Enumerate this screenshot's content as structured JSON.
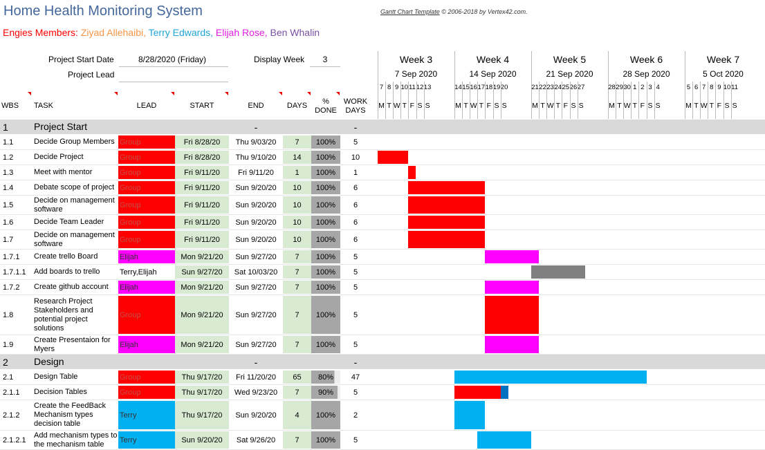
{
  "title": "Home Health Monitoring System",
  "credit": {
    "link": "Gantt Chart Template",
    "rest": " © 2006-2018 by Vertex42.com."
  },
  "members": {
    "label": "Engies Members: ",
    "names": [
      {
        "name": "Ziyad Allehaibi",
        "sep": ", ",
        "color": "#f79646"
      },
      {
        "name": "Terry Edwards",
        "sep": ", ",
        "color": "#20a4d8"
      },
      {
        "name": "Elijah Rose",
        "sep": ", ",
        "color": "#e020e0"
      },
      {
        "name": "Ben Whalin",
        "sep": "",
        "color": "#7a4fa5"
      }
    ]
  },
  "fields": {
    "start_label": "Project Start Date",
    "start_value": "8/28/2020 (Friday)",
    "lead_label": "Project Lead",
    "lead_value": "",
    "week_label": "Display Week",
    "week_value": "3"
  },
  "columns": {
    "wbs": "WBS",
    "task": "TASK",
    "lead": "LEAD",
    "start": "START",
    "end": "END",
    "days": "DAYS",
    "done1": "%",
    "done2": "DONE",
    "work1": "WORK",
    "work2": "DAYS"
  },
  "weeks": [
    {
      "label": "Week 3",
      "date": "7 Sep 2020",
      "days": [
        "7",
        "8",
        "9",
        "10",
        "11",
        "12",
        "13"
      ]
    },
    {
      "label": "Week 4",
      "date": "14 Sep 2020",
      "days": [
        "14",
        "15",
        "16",
        "17",
        "18",
        "19",
        "20"
      ]
    },
    {
      "label": "Week 5",
      "date": "21 Sep 2020",
      "days": [
        "21",
        "22",
        "23",
        "24",
        "25",
        "26",
        "27"
      ]
    },
    {
      "label": "Week 6",
      "date": "28 Sep 2020",
      "days": [
        "28",
        "29",
        "30",
        "1",
        "2",
        "3",
        "4"
      ]
    },
    {
      "label": "Week 7",
      "date": "5 Oct 2020",
      "days": [
        "5",
        "6",
        "7",
        "8",
        "9",
        "10",
        "11"
      ]
    }
  ],
  "weekday_letters": [
    "M",
    "T",
    "W",
    "T",
    "F",
    "S",
    "S"
  ],
  "colors": {
    "red": "#ff0000",
    "magenta": "#ff00ff",
    "blue": "#00b0f0",
    "gray": "#808080",
    "green_cell": "#d9ead3",
    "progress": "#a6a6a6",
    "phase": "#d9d9d9",
    "dark_blue": "#0070c0"
  },
  "rows": [
    {
      "type": "phase",
      "wbs": "1",
      "task": "Project Start",
      "end": "-",
      "work": "-"
    },
    {
      "wbs": "1.1",
      "task": "Decide Group Members",
      "lead": "Group",
      "lead_color": "red",
      "start": "Fri 8/28/20",
      "end": "Thu 9/03/20",
      "days": "7",
      "done": "100%",
      "work": "5",
      "bar": null
    },
    {
      "wbs": "1.2",
      "task": "Decide Project",
      "lead": "Group",
      "lead_color": "red",
      "start": "Fri 8/28/20",
      "end": "Thu 9/10/20",
      "days": "14",
      "done": "100%",
      "work": "10",
      "bar": {
        "from": 0,
        "to": 4,
        "color": "red"
      }
    },
    {
      "wbs": "1.3",
      "task": "Meet with mentor",
      "lead": "Group",
      "lead_color": "red",
      "start": "Fri 9/11/20",
      "end": "Fri 9/11/20",
      "days": "1",
      "done": "100%",
      "work": "1",
      "bar": {
        "from": 4,
        "to": 5,
        "color": "red"
      }
    },
    {
      "wbs": "1.4",
      "task": "Debate scope of project",
      "lead": "Group",
      "lead_color": "red",
      "start": "Fri 9/11/20",
      "end": "Sun 9/20/20",
      "days": "10",
      "done": "100%",
      "work": "6",
      "bar": {
        "from": 4,
        "to": 14,
        "color": "red"
      }
    },
    {
      "wbs": "1.5",
      "task": "Decide on management software",
      "lead": "Group",
      "lead_color": "red",
      "start": "Fri 9/11/20",
      "end": "Sun 9/20/20",
      "days": "10",
      "done": "100%",
      "work": "6",
      "tall": true,
      "bar": {
        "from": 4,
        "to": 14,
        "color": "red"
      }
    },
    {
      "wbs": "1.6",
      "task": "Decide Team Leader",
      "lead": "Group",
      "lead_color": "red",
      "start": "Fri 9/11/20",
      "end": "Sun 9/20/20",
      "days": "10",
      "done": "100%",
      "work": "6",
      "bar": {
        "from": 4,
        "to": 14,
        "color": "red"
      }
    },
    {
      "wbs": "1.7",
      "task": "Decide on management software",
      "lead": "Group",
      "lead_color": "red",
      "start": "Fri 9/11/20",
      "end": "Sun 9/20/20",
      "days": "10",
      "done": "100%",
      "work": "6",
      "tall": true,
      "bar": {
        "from": 4,
        "to": 14,
        "color": "red"
      }
    },
    {
      "wbs": "1.7.1",
      "task": "Create trello Board",
      "lead": "Elijah",
      "lead_color": "magenta",
      "start": "Mon 9/21/20",
      "end": "Sun 9/27/20",
      "days": "7",
      "done": "100%",
      "work": "5",
      "bar": {
        "from": 14,
        "to": 21,
        "color": "magenta"
      }
    },
    {
      "wbs": "1.7.1.1",
      "task": "Add boards to trello",
      "lead": "Terry,Elijah",
      "lead_color": "none",
      "start": "Sun 9/27/20",
      "end": "Sat 10/03/20",
      "days": "7",
      "done": "100%",
      "work": "5",
      "bar": {
        "from": 20,
        "to": 27,
        "color": "gray"
      }
    },
    {
      "wbs": "1.7.2",
      "task": "Create github account",
      "lead": "Elijah",
      "lead_color": "magenta",
      "start": "Mon 9/21/20",
      "end": "Sun 9/27/20",
      "days": "7",
      "done": "100%",
      "work": "5",
      "bar": {
        "from": 14,
        "to": 21,
        "color": "magenta"
      }
    },
    {
      "wbs": "1.8",
      "task": "Research Project Stakeholders and potential project solutions",
      "lead": "Group",
      "lead_color": "red",
      "start": "Mon 9/21/20",
      "end": "Sun 9/27/20",
      "days": "7",
      "done": "100%",
      "work": "5",
      "huge": true,
      "bar": {
        "from": 14,
        "to": 21,
        "color": "red"
      }
    },
    {
      "wbs": "1.9",
      "task": "Create Presentaion for Myers",
      "lead": "Elijah",
      "lead_color": "magenta",
      "start": "Mon 9/21/20",
      "end": "Sun 9/27/20",
      "days": "7",
      "done": "100%",
      "work": "5",
      "tall": true,
      "bar": {
        "from": 14,
        "to": 21,
        "color": "magenta"
      }
    },
    {
      "type": "phase",
      "wbs": "2",
      "task": "Design",
      "end": "-",
      "work": "-"
    },
    {
      "wbs": "2.1",
      "task": "Design Table",
      "lead": "Group",
      "lead_color": "red",
      "start": "Thu 9/17/20",
      "end": "Fri 11/20/20",
      "days": "65",
      "done": "80%",
      "work": "47",
      "bar": {
        "from": 10,
        "to": 35,
        "color": "blue"
      }
    },
    {
      "wbs": "2.1.1",
      "task": "Decision Tables",
      "lead": "Group",
      "lead_color": "red",
      "start": "Thu 9/17/20",
      "end": "Wed 9/23/20",
      "days": "7",
      "done": "90%",
      "work": "5",
      "bar": {
        "from": 10,
        "to": 17,
        "color": "red",
        "split": 16,
        "split_color": "dark_blue"
      }
    },
    {
      "wbs": "2.1.2",
      "task": "Create the FeedBack Mechanism types decision table",
      "lead": "Terry",
      "lead_color": "blue",
      "start": "Thu 9/17/20",
      "end": "Sun 9/20/20",
      "days": "4",
      "done": "100%",
      "work": "2",
      "huge2": true,
      "bar": {
        "from": 10,
        "to": 14,
        "color": "blue"
      }
    },
    {
      "wbs": "2.1.2.1",
      "task": "Add mechanism types to the mechanism table",
      "lead": "Terry",
      "lead_color": "blue",
      "start": "Sun 9/20/20",
      "end": "Sat 9/26/20",
      "days": "7",
      "done": "100%",
      "work": "5",
      "tall": true,
      "bar": {
        "from": 13,
        "to": 20,
        "color": "blue"
      }
    }
  ]
}
